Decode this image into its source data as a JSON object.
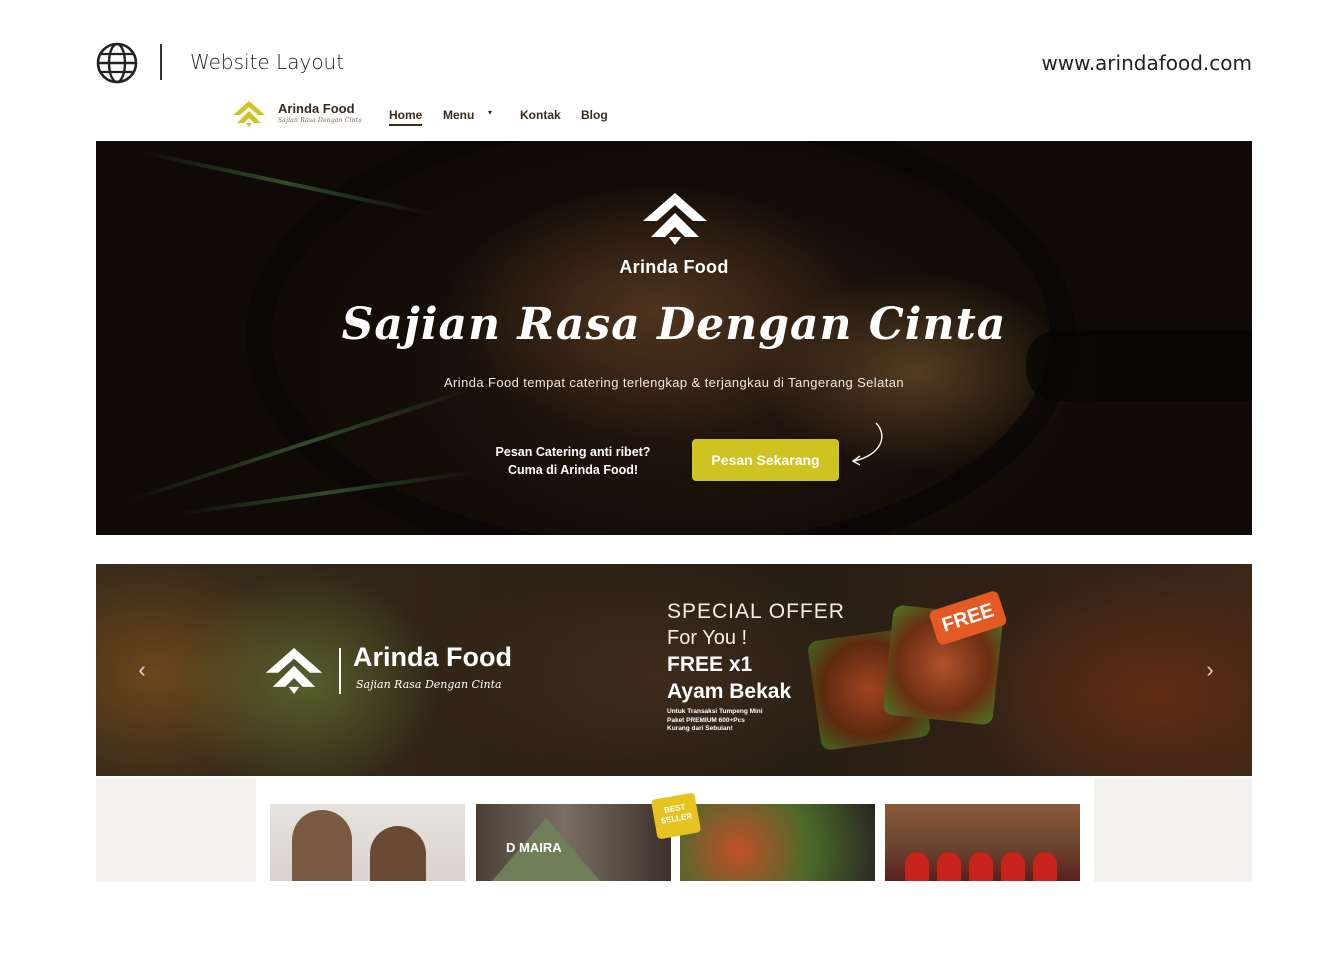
{
  "presentation": {
    "title": "Website Layout",
    "url": "www.arindafood.com",
    "globe_icon": "globe-icon"
  },
  "nav": {
    "brand": "Arinda Food",
    "tagline": "Sajian Rasa Dengan Cinta",
    "links": {
      "home": "Home",
      "menu": "Menu",
      "kontak": "Kontak",
      "blog": "Blog"
    },
    "active": "Home",
    "menu_caret": "▾"
  },
  "hero": {
    "brand": "Arinda Food",
    "slogan": "Sajian Rasa Dengan Cinta",
    "subtitle": "Arinda Food tempat catering terlengkap & terjangkau di Tangerang Selatan",
    "cta_question_line1": "Pesan Catering anti ribet?",
    "cta_question_line2": "Cuma di Arinda Food!",
    "cta_button": "Pesan Sekarang"
  },
  "promo": {
    "brand": "Arinda Food",
    "tagline": "Sajian Rasa Dengan Cinta",
    "offer_line1": "SPECIAL OFFER",
    "offer_line2": "For You !",
    "free_line": "FREE x1",
    "dish_line": "Ayam Bekak",
    "note_line1": "Untuk Transaksi Tumpeng Mini",
    "note_line2": "Paket PREMIUM 600+Pcs",
    "note_line3": "Kurang dari Sebulan!",
    "badge": "FREE",
    "prev": "‹",
    "next": "›"
  },
  "gallery": {
    "badge_line1": "BEST",
    "badge_line2": "SELLER",
    "cone_label": "D MAIRA"
  },
  "colors": {
    "accent": "#cfc321",
    "brand_dark": "#3a2a1a",
    "promo_badge": "#e35a22"
  }
}
